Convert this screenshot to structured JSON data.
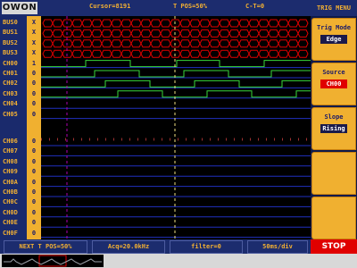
{
  "logo": "OWON",
  "header": {
    "cursor": "Cursor=8191",
    "tpos": "T POS=50%",
    "ct": "C-T=0"
  },
  "rows": [
    {
      "label": "BUS0",
      "value": "X"
    },
    {
      "label": "BUS1",
      "value": "X"
    },
    {
      "label": "BUS2",
      "value": "X"
    },
    {
      "label": "BUS3",
      "value": "X"
    },
    {
      "label": "CH00",
      "value": "1"
    },
    {
      "label": "CH01",
      "value": "0"
    },
    {
      "label": "CH02",
      "value": "0"
    },
    {
      "label": "CH03",
      "value": "0"
    },
    {
      "label": "CH04",
      "value": "0"
    },
    {
      "label": "CH05",
      "value": "0"
    },
    {
      "label": "CH06",
      "value": "0"
    },
    {
      "label": "CH07",
      "value": "0"
    },
    {
      "label": "CH08",
      "value": "0"
    },
    {
      "label": "CH09",
      "value": "0"
    },
    {
      "label": "CH0A",
      "value": "0"
    },
    {
      "label": "CH0B",
      "value": "0"
    },
    {
      "label": "CH0C",
      "value": "0"
    },
    {
      "label": "CH0D",
      "value": "0"
    },
    {
      "label": "CH0E",
      "value": "0"
    },
    {
      "label": "CH0F",
      "value": "0"
    }
  ],
  "menu": {
    "title": "TRIG MENU",
    "items": [
      {
        "title": "Trig Mode",
        "value": "Edge"
      },
      {
        "title": "Source",
        "value": "CH00"
      },
      {
        "title": "Slope",
        "value": "Rising"
      }
    ]
  },
  "footer": {
    "next_tpos": "NEXT T POS=50%",
    "acq": "Acq=20.0kHz",
    "filter": "filter=0",
    "timebase": "50ms/div",
    "stop": "STOP"
  },
  "colors": {
    "bus": "#e00000",
    "trace": "#37d83a",
    "baseline": "#2030c0",
    "cursor1": "#b000b0",
    "cursor2": "#f0e080"
  }
}
